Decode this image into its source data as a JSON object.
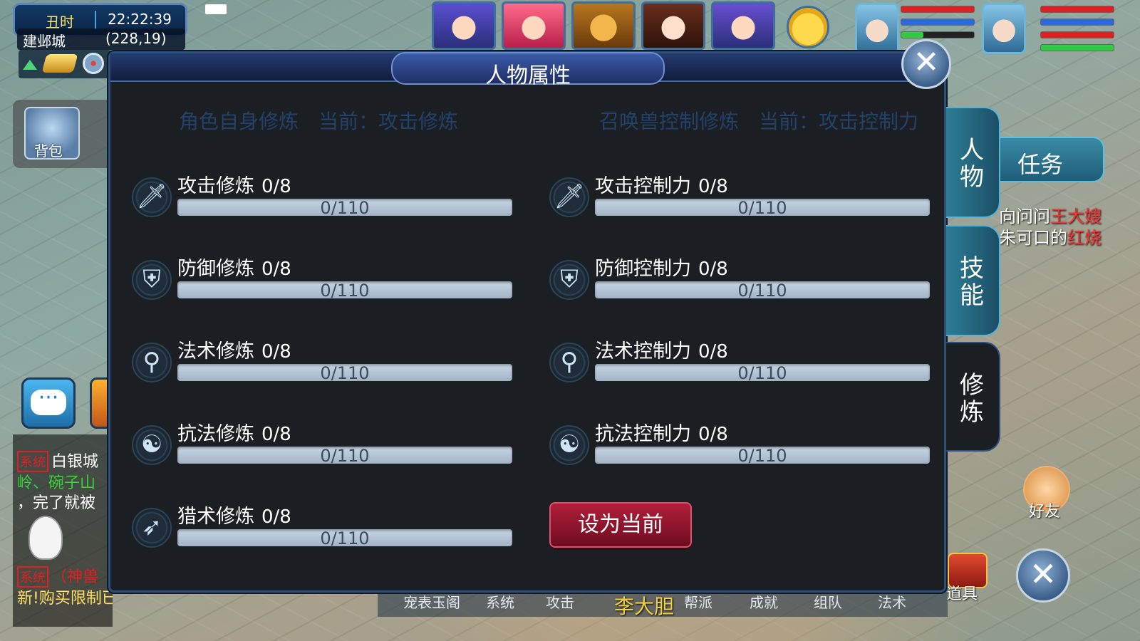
{
  "hud": {
    "time_period": "丑时",
    "clock": "22:22:39",
    "map_name": "建邺城",
    "coordinates": "(228,19)",
    "bag_label": "背包"
  },
  "team_portraits": 5,
  "right_panel": {
    "task_tab_label": "任务",
    "quest_line_1_prefix": "向问问",
    "quest_line_1_name": "王大嫂",
    "quest_line_2_prefix": "朱可口的",
    "quest_line_2_item": "红烧",
    "friend_label": "好友",
    "item_label": "道具"
  },
  "chat": {
    "sys_tag": "系统",
    "line_1": "白银城",
    "line_2": "岭、碗子山",
    "line_3": "，完了就被",
    "line_4": "（神兽",
    "line_5": "新!购买限制已清空！"
  },
  "bottom_menu": [
    "宠表玉阁",
    "系统",
    "攻击",
    "帮派",
    "成就",
    "组队",
    "法术"
  ],
  "npc_name": "李大胆",
  "dialog": {
    "title": "人物属性",
    "left_heading": "角色自身修炼　当前：攻击修炼",
    "right_heading": "召唤兽控制修炼　当前：攻击控制力",
    "set_current_label": "设为当前",
    "left_rows": [
      {
        "icon": "sword-icon",
        "label": "攻击修炼",
        "level": "0/8",
        "exp": "0/110",
        "progress": 0
      },
      {
        "icon": "shield-icon",
        "label": "防御修炼",
        "level": "0/8",
        "exp": "0/110",
        "progress": 0
      },
      {
        "icon": "magic-staff-icon",
        "label": "法术修炼",
        "level": "0/8",
        "exp": "0/110",
        "progress": 0
      },
      {
        "icon": "yin-yang-icon",
        "label": "抗法修炼",
        "level": "0/8",
        "exp": "0/110",
        "progress": 0
      },
      {
        "icon": "bow-icon",
        "label": "猎术修炼",
        "level": "0/8",
        "exp": "0/110",
        "progress": 0
      }
    ],
    "right_rows": [
      {
        "icon": "sword-icon",
        "label": "攻击控制力",
        "level": "0/8",
        "exp": "0/110",
        "progress": 0
      },
      {
        "icon": "shield-icon",
        "label": "防御控制力",
        "level": "0/8",
        "exp": "0/110",
        "progress": 0
      },
      {
        "icon": "magic-staff-icon",
        "label": "法术控制力",
        "level": "0/8",
        "exp": "0/110",
        "progress": 0
      },
      {
        "icon": "yin-yang-icon",
        "label": "抗法控制力",
        "level": "0/8",
        "exp": "0/110",
        "progress": 0
      }
    ],
    "side_tabs": [
      {
        "label": "人物",
        "active": false
      },
      {
        "label": "技能",
        "active": false
      },
      {
        "label": "修炼",
        "active": true
      }
    ]
  },
  "colors": {
    "dialog_bg": "#1b1f23",
    "header_blue": "#243a70",
    "button_red": "#b21e3a",
    "progress_track": "#c9d7e6",
    "hp_red": "#e02020",
    "mp_blue": "#2a6ae0",
    "sp_green": "#2ecc40"
  },
  "status_bars": [
    {
      "hp": 1,
      "mp": 1,
      "sp": 0.3
    },
    {
      "hp": 1,
      "mp": 1,
      "sp": 1
    }
  ]
}
